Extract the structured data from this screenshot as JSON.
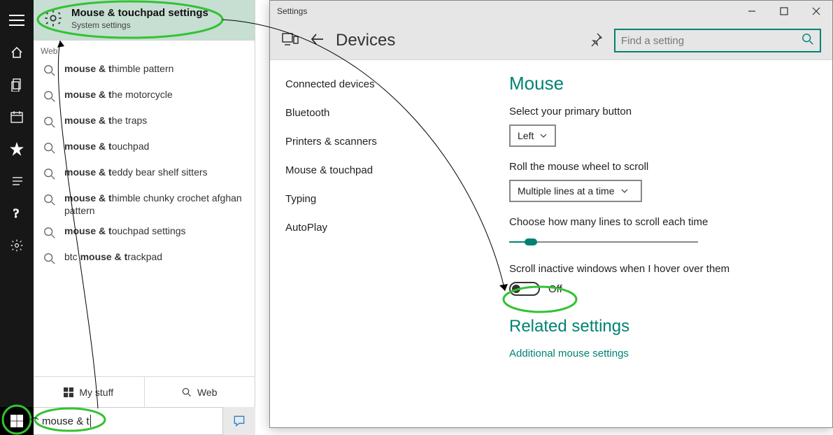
{
  "cortana": {
    "best_match": {
      "title": "Mouse & touchpad settings",
      "subtitle": "System settings"
    },
    "web_label": "Web",
    "web_items_bold_prefix": "mouse & t",
    "web_items": [
      {
        "suffix": "himble pattern"
      },
      {
        "suffix": "he motorcycle"
      },
      {
        "suffix": "he traps"
      },
      {
        "suffix": "ouchpad"
      },
      {
        "suffix": "eddy bear shelf sitters"
      },
      {
        "suffix": "himble chunky crochet afghan pattern"
      },
      {
        "suffix": "ouchpad settings"
      }
    ],
    "web_items_alt": {
      "full_line": "btc mouse & trackpad",
      "emph_from": "mouse & t"
    },
    "tabs": {
      "stuff": "My stuff",
      "web": "Web"
    },
    "search_text": "mouse & t"
  },
  "settings": {
    "window_title": "Settings",
    "header_title": "Devices",
    "find_placeholder": "Find a setting",
    "nav": [
      "Connected devices",
      "Bluetooth",
      "Printers & scanners",
      "Mouse & touchpad",
      "Typing",
      "AutoPlay"
    ],
    "mouse": {
      "heading": "Mouse",
      "primary_label": "Select your primary button",
      "primary_value": "Left",
      "wheel_label": "Roll the mouse wheel to scroll",
      "wheel_value": "Multiple lines at a time",
      "lines_label": "Choose how many lines to scroll each time",
      "inactive_label": "Scroll inactive windows when I hover over them",
      "inactive_state": "Off",
      "related_heading": "Related settings",
      "additional_link": "Additional mouse settings"
    }
  }
}
